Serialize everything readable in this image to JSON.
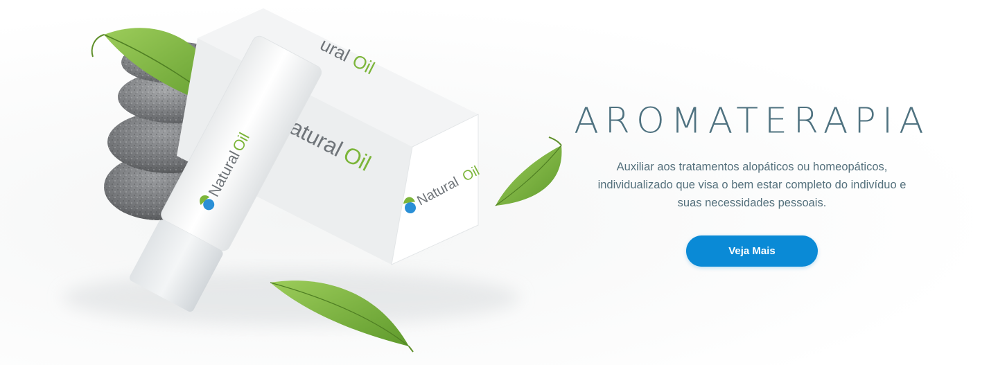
{
  "hero": {
    "title": "Aromaterapia",
    "description": "Auxiliar aos tratamentos alopáticos ou homeopáticos, individualizado que visa o bem estar completo do indivíduo e suas necessidades pessoais.",
    "cta_label": "Veja Mais"
  },
  "product": {
    "brand_word_1": "Natural",
    "brand_word_2": "Oil"
  },
  "colors": {
    "accent": "#0a8ad6",
    "title": "#4f7280",
    "text": "#54707c",
    "brand_green": "#7cb53a",
    "brand_gray": "#6f7479"
  }
}
